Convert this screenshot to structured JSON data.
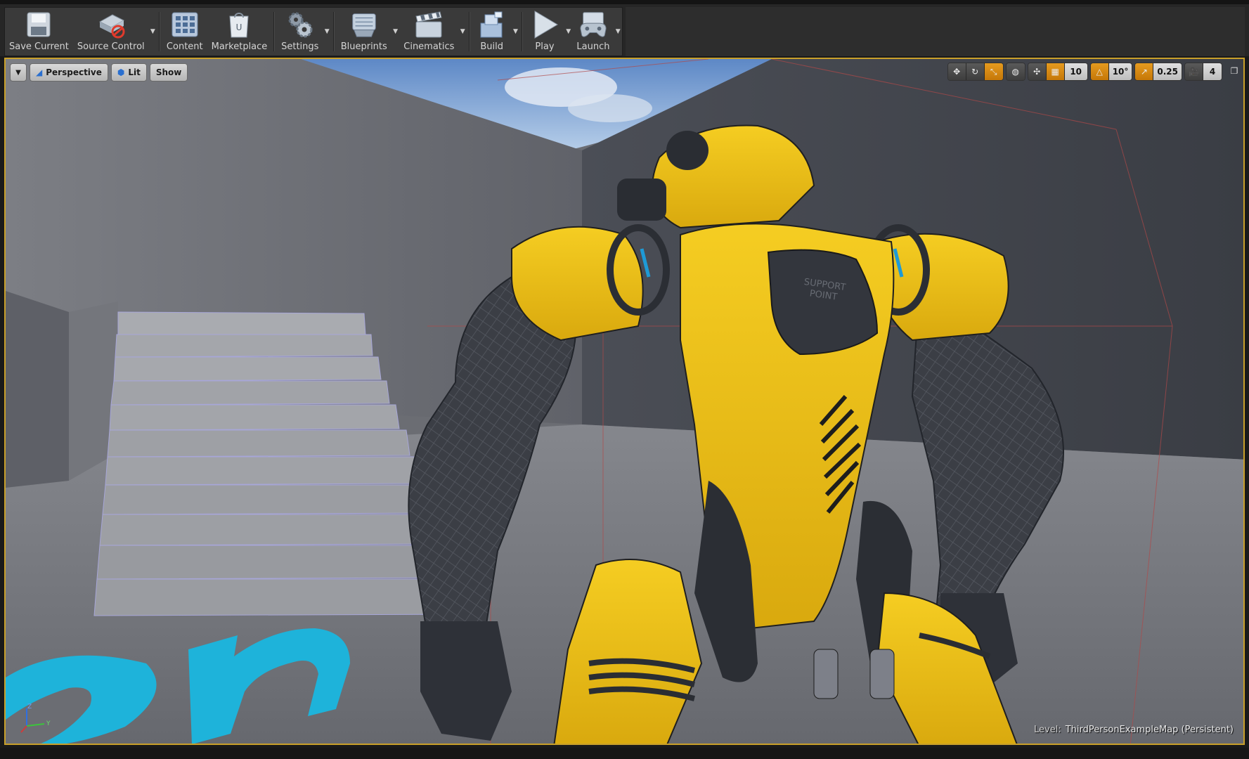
{
  "toolbar": {
    "save_current": "Save Current",
    "source_control": "Source Control",
    "content": "Content",
    "marketplace": "Marketplace",
    "settings": "Settings",
    "blueprints": "Blueprints",
    "cinematics": "Cinematics",
    "build": "Build",
    "play": "Play",
    "launch": "Launch"
  },
  "viewport": {
    "view_mode": "Perspective",
    "lighting": "Lit",
    "show": "Show",
    "grid_snap": "10",
    "rotation_snap": "10°",
    "scale_snap": "0.25",
    "camera_speed": "4",
    "level_key": "Level:",
    "level_name": "ThirdPersonExampleMap (Persistent)",
    "gizmo_z": "Z",
    "gizmo_y": "Y"
  },
  "colors": {
    "accent": "#c9a02a",
    "active_orange": "#e08a12",
    "robot_yellow": "#f2c41a",
    "floor_text_blue": "#1eb3da"
  }
}
